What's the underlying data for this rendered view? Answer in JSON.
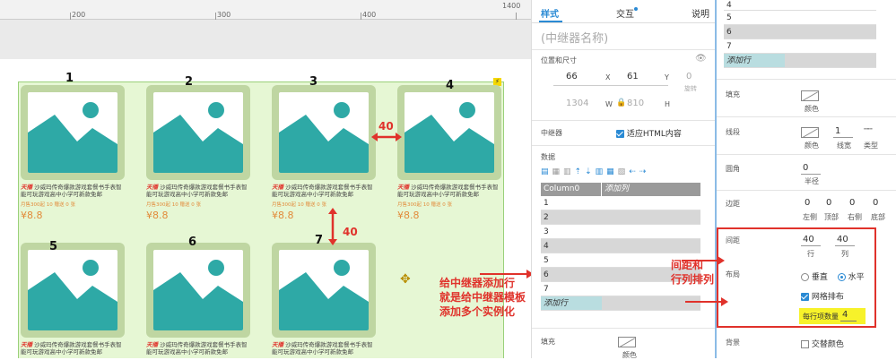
{
  "ruler": {
    "marks": [
      "200",
      "300",
      "400",
      "1400"
    ]
  },
  "canvas": {
    "item_numbers": [
      "1",
      "2",
      "3",
      "4",
      "5",
      "6",
      "7"
    ],
    "product": {
      "brand": "天播",
      "desc_line1": "沙威玛传奇爆款游戏套餐书手表智",
      "desc_line2": "能可玩游戏高中小学可新款免邮",
      "sales": "月售300起 10   赠送 0 张",
      "price": "¥8.8"
    },
    "gap_label_horizontal": "40",
    "gap_label_vertical": "40",
    "annotation_left": [
      "给中继器添加行",
      "就是给中继器模板",
      "添加多个实例化"
    ],
    "annotation_right": [
      "间距和",
      "行列排列"
    ]
  },
  "panel": {
    "tabs": [
      "样式",
      "交互",
      "说明"
    ],
    "name_placeholder": "(中继器名称)",
    "pos_size_label": "位置和尺寸",
    "x": "66",
    "x_unit": "X",
    "y": "61",
    "y_unit": "Y",
    "rotation": "0",
    "rotation_label": "旋转",
    "w": "1304",
    "w_unit": "W",
    "h": "810",
    "h_unit": "H",
    "repeater_label": "中继器",
    "fit_html": "适应HTML内容",
    "data_label": "数据",
    "column_header": "Column0",
    "add_column": "添加列",
    "rows": [
      "1",
      "2",
      "3",
      "4",
      "5",
      "6",
      "7"
    ],
    "add_row": "添加行",
    "fill_label": "填充",
    "color_label": "颜色"
  },
  "rpanel": {
    "top_rows": [
      "4",
      "5",
      "6",
      "7"
    ],
    "add_row": "添加行",
    "fill_label": "填充",
    "fill_color": "颜色",
    "border_label": "线段",
    "border_color": "颜色",
    "border_width": "1",
    "border_width_label": "线宽",
    "border_type": "类型",
    "radius_label": "圆角",
    "radius_value": "0",
    "radius_sub": "半径",
    "padding_label": "边距",
    "padding_values": [
      "0",
      "0",
      "0",
      "0"
    ],
    "padding_sub": [
      "左侧",
      "顶部",
      "右侧",
      "底部"
    ],
    "spacing_label": "间距",
    "row_spacing": "40",
    "row_label": "行",
    "col_spacing": "40",
    "col_label": "列",
    "layout_label": "布局",
    "vertical": "垂直",
    "horizontal": "水平",
    "grid": "网格排布",
    "per_row_label": "每行项数量",
    "per_row_value": "4",
    "bg_label": "背景",
    "alt_color": "交替颜色"
  }
}
